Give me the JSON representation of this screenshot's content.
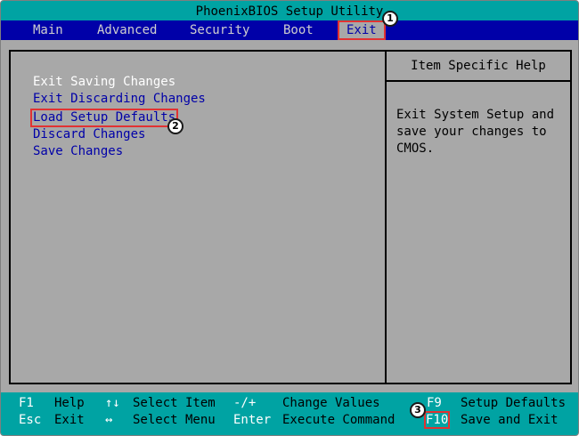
{
  "title": "PhoenixBIOS Setup Utility",
  "menu": {
    "items": [
      "Main",
      "Advanced",
      "Security",
      "Boot",
      "Exit"
    ],
    "active": "Exit"
  },
  "exit_menu": {
    "options": [
      "Exit Saving Changes",
      "Exit Discarding Changes",
      "Load Setup Defaults",
      "Discard Changes",
      "Save Changes"
    ]
  },
  "help": {
    "header": "Item Specific Help",
    "lines": [
      "Exit System Setup and",
      "save your changes to",
      "CMOS."
    ]
  },
  "footer": {
    "row1": [
      {
        "key": "F1",
        "desc": "Help"
      },
      {
        "key": "↑↓",
        "desc": "Select Item"
      },
      {
        "key": "-/+",
        "desc": "Change Values"
      },
      {
        "key": "F9",
        "desc": "Setup Defaults"
      }
    ],
    "row2": [
      {
        "key": "Esc",
        "desc": "Exit"
      },
      {
        "key": "↔",
        "desc": "Select Menu"
      },
      {
        "key": "Enter",
        "desc": "Execute Command"
      },
      {
        "key": "F10",
        "desc": "Save and Exit"
      }
    ]
  },
  "annotations": [
    "1",
    "2",
    "3"
  ],
  "colors": {
    "background": "#a8a8a8",
    "menubar": "#0000a8",
    "titlebar": "#00a3a3",
    "highlight_box": "#e23232"
  }
}
